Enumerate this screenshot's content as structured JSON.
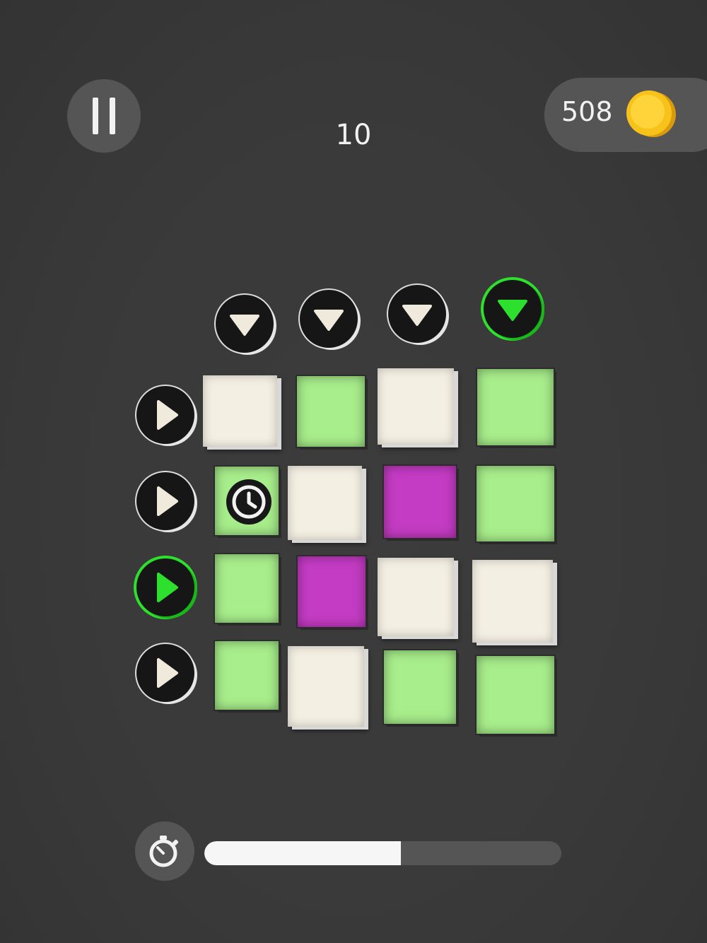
{
  "hud": {
    "score": "10",
    "coins": "508"
  },
  "column_buttons": [
    {
      "direction": "down",
      "active": false
    },
    {
      "direction": "down",
      "active": false
    },
    {
      "direction": "down",
      "active": false
    },
    {
      "direction": "down",
      "active": true
    }
  ],
  "row_buttons": [
    {
      "direction": "right",
      "active": false
    },
    {
      "direction": "right",
      "active": false
    },
    {
      "direction": "right",
      "active": true
    },
    {
      "direction": "right",
      "active": false
    }
  ],
  "grid": [
    [
      "white",
      "green",
      "white",
      "green"
    ],
    [
      "green",
      "white",
      "magenta",
      "green"
    ],
    [
      "green",
      "magenta",
      "white",
      "white"
    ],
    [
      "green",
      "white",
      "green",
      "green"
    ]
  ],
  "special_tiles": [
    {
      "row": 1,
      "col": 0,
      "icon": "clock-icon"
    }
  ],
  "timer": {
    "icon": "stopwatch-icon",
    "progress": 0.55
  },
  "colors": {
    "background": "#3a3a3a",
    "white_tile": "#f4efe3",
    "green_tile": "#a8ee8c",
    "magenta_tile": "#c43cc4",
    "active_accent": "#2de02d",
    "coin": "#f7c21a"
  }
}
